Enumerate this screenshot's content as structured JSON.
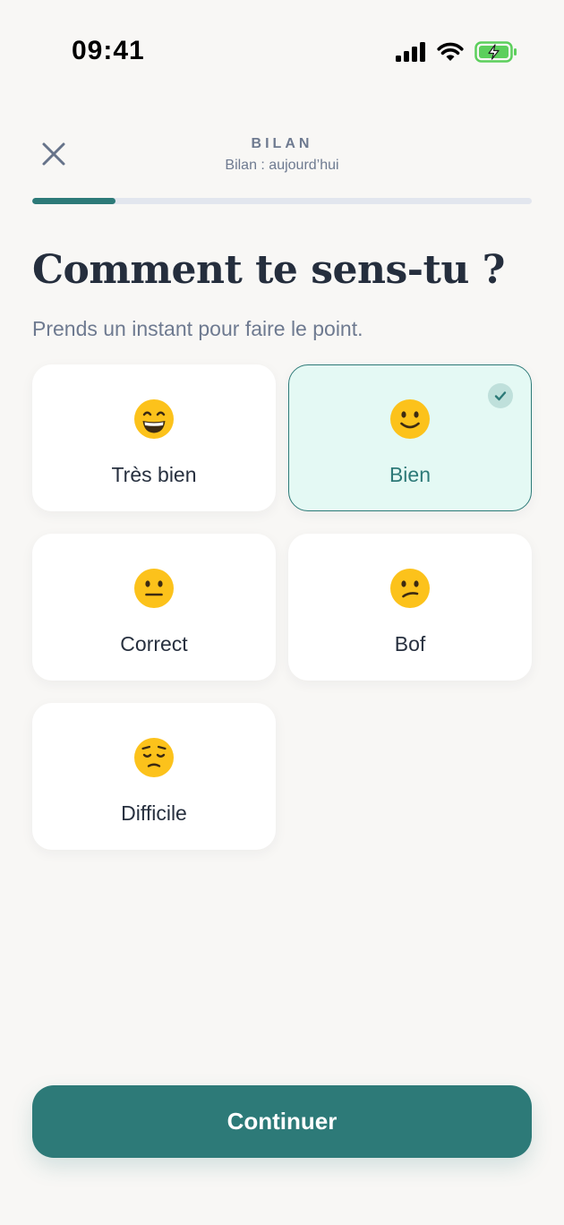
{
  "status_bar": {
    "time": "09:41",
    "icons": [
      "cellular-signal-icon",
      "wifi-icon",
      "battery-charging-icon"
    ]
  },
  "header": {
    "kicker": "BILAN",
    "subtitle": "Bilan : aujourd’hui",
    "close_icon": "close-icon"
  },
  "progress": {
    "fraction": 0.167
  },
  "question": {
    "title": "Comment te sens-tu ?",
    "subtitle": "Prends un instant pour faire le point."
  },
  "options": [
    {
      "label": "Très bien",
      "icon": "grinning-face-icon",
      "selected": false
    },
    {
      "label": "Bien",
      "icon": "slightly-smiling-face-icon",
      "selected": true
    },
    {
      "label": "Correct",
      "icon": "neutral-face-icon",
      "selected": false
    },
    {
      "label": "Bof",
      "icon": "confused-face-icon",
      "selected": false
    },
    {
      "label": "Difficile",
      "icon": "pensive-face-icon",
      "selected": false
    }
  ],
  "continue_label": "Continuer",
  "colors": {
    "accent": "#2d7a78",
    "selected_bg": "#e4f9f4",
    "background": "#f8f7f5",
    "text_primary": "#252e3d",
    "text_secondary": "#6e7a90"
  }
}
